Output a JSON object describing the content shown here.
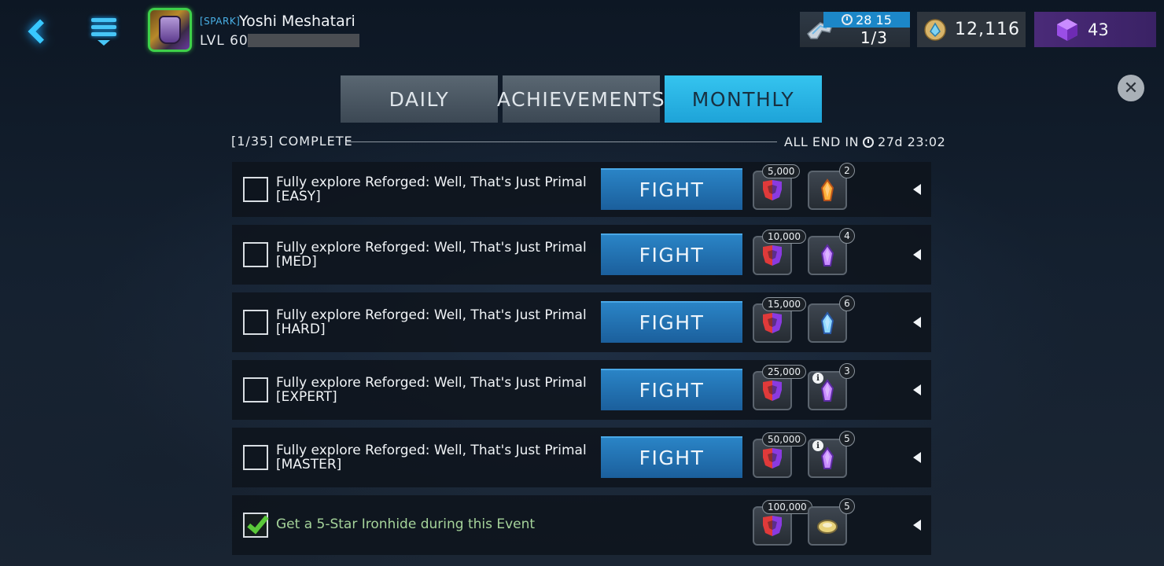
{
  "player": {
    "tag": "[SPARK]",
    "name": "Yoshi Meshatari",
    "level": "LVL 60"
  },
  "resources": {
    "energy_timer": "28 15",
    "energy_count": "1/3",
    "gold": "12,116",
    "gems": "43"
  },
  "tabs": [
    {
      "label": "DAILY",
      "active": false
    },
    {
      "label": "ACHIEVEMENTS",
      "active": false
    },
    {
      "label": "MONTHLY",
      "active": true
    }
  ],
  "progress": {
    "complete_label": "[1/35] COMPLETE",
    "end_prefix": "ALL END IN",
    "end_time": "27d 23:02"
  },
  "fight_label": "FIGHT",
  "quests": [
    {
      "title": "Fully explore Reforged: Well, That's Just Primal",
      "difficulty": "[EASY]",
      "checked": false,
      "has_fight": true,
      "currency": "5,000",
      "item_count": "2",
      "item_icon": "orange-crystal-icon",
      "item_info": false
    },
    {
      "title": "Fully explore Reforged: Well, That's Just Primal",
      "difficulty": "[MED]",
      "checked": false,
      "has_fight": true,
      "currency": "10,000",
      "item_count": "4",
      "item_icon": "purple-crystal-icon",
      "item_info": false
    },
    {
      "title": "Fully explore Reforged: Well, That's Just Primal",
      "difficulty": "[HARD]",
      "checked": false,
      "has_fight": true,
      "currency": "15,000",
      "item_count": "6",
      "item_icon": "blue-crystal-icon",
      "item_info": false
    },
    {
      "title": "Fully explore Reforged: Well, That's Just Primal",
      "difficulty": "[EXPERT]",
      "checked": false,
      "has_fight": true,
      "currency": "25,000",
      "item_count": "3",
      "item_icon": "purple-crystal-icon",
      "item_info": true
    },
    {
      "title": "Fully explore Reforged: Well, That's Just Primal",
      "difficulty": "[MASTER]",
      "checked": false,
      "has_fight": true,
      "currency": "50,000",
      "item_count": "5",
      "item_icon": "purple-crystal-icon",
      "item_info": true
    },
    {
      "title": "Get a 5-Star Ironhide during this Event",
      "difficulty": "",
      "checked": true,
      "has_fight": false,
      "currency": "100,000",
      "item_count": "5",
      "item_icon": "gold-ore-icon",
      "item_info": false
    }
  ],
  "colors": {
    "accent": "#1ea3d8",
    "fight": "#1b5f9c",
    "complete": "#5ac83a"
  }
}
